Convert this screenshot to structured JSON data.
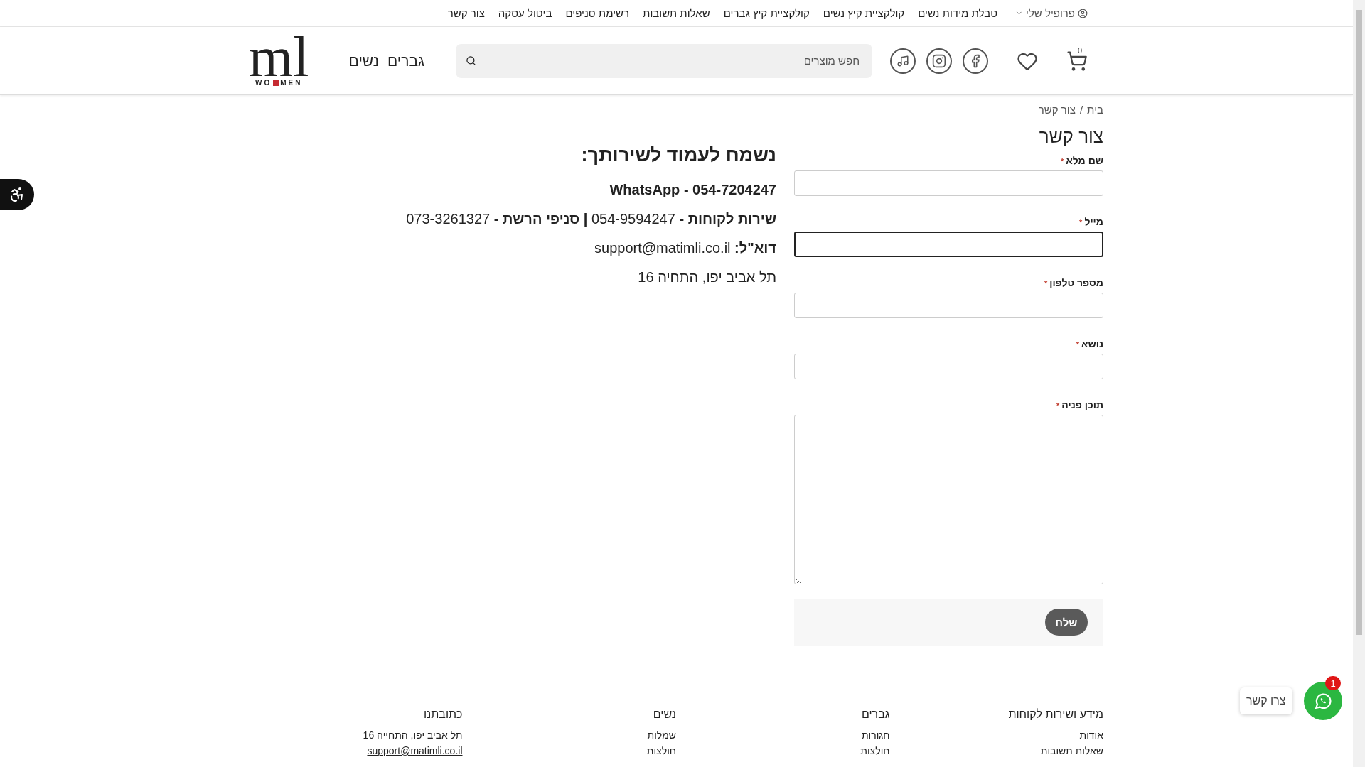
{
  "top_bar": {
    "profile": "פרופיל שלי",
    "links": [
      "טבלת מידות נשים",
      "קולקציית קיץ נשים",
      "קולקציית קיץ גברים",
      "שאלות תשובות",
      "רשימת סניפים",
      "ביטול עסקה",
      "צור קשר"
    ]
  },
  "header": {
    "cart_count": "0",
    "search": {
      "placeholder": "חפש מוצרים"
    },
    "nav": [
      "גברים",
      "נשים"
    ],
    "logo": {
      "main": "ml",
      "sub_start": "WO",
      "sub_end": "MEN"
    }
  },
  "breadcrumb": [
    "בית",
    "/",
    "צור קשר"
  ],
  "page_title": "צור קשר",
  "form": {
    "fields": [
      {
        "kind": "input",
        "label": "שם מלא",
        "asterisk": "*",
        "focused": false
      },
      {
        "kind": "input",
        "label": "מייל",
        "asterisk": "*",
        "focused": true
      },
      {
        "kind": "input",
        "label": "מספר טלפון",
        "asterisk": "*",
        "focused": false
      },
      {
        "kind": "input",
        "label": "נושא",
        "asterisk": "*",
        "focused": false
      },
      {
        "kind": "textarea",
        "label": "תוכן פניה",
        "asterisk": "*",
        "focused": false
      }
    ],
    "submit": "שלח"
  },
  "info": {
    "title": "נשמח לעמוד לשירותך:",
    "lines": [
      "**WhatsApp - 054-7204247**",
      "**שירות לקוחות -** 054-9594247 **| סניפי הרשת -** 073-3261327",
      "**דוא\"ל:** support@matimli.co.il",
      "תל אביב יפו, התחיה 16"
    ]
  },
  "footer": {
    "columns": [
      {
        "title": "מידע ושירות לקוחות",
        "links": [
          "אודות",
          "שאלות תשובות"
        ]
      },
      {
        "title": "גברים",
        "links": [
          "חגורות",
          "חולצות"
        ]
      },
      {
        "title": "נשים",
        "links": [
          "שמלות",
          "חולצות"
        ]
      },
      {
        "title": "כתובתנו",
        "links": [
          "תל אביב יפו, התחייה 16",
          "support@matimli.co.il"
        ]
      }
    ]
  },
  "chat": {
    "label": "צרו קשר",
    "badge": "1"
  }
}
